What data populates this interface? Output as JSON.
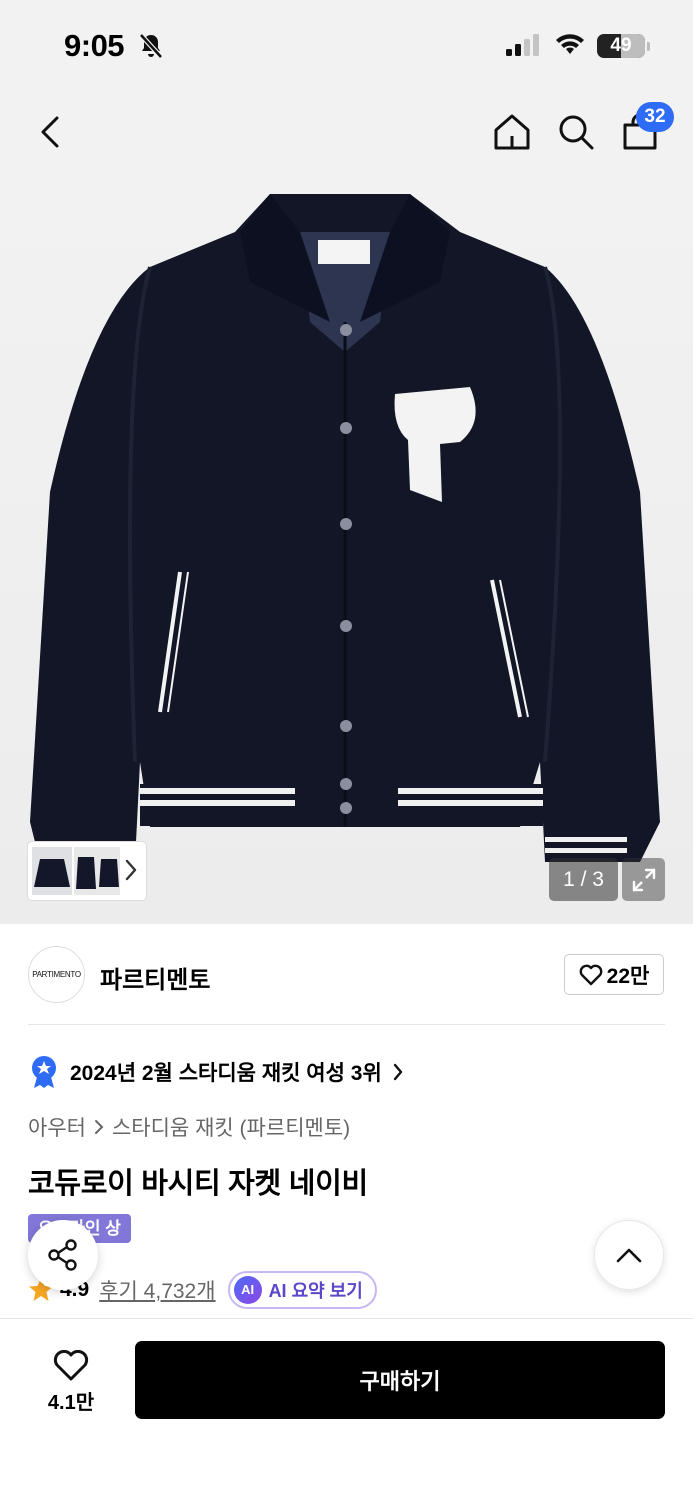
{
  "status_bar": {
    "time": "9:05",
    "battery": "49"
  },
  "header": {
    "cart_count": "32"
  },
  "gallery": {
    "counter": "1 / 3"
  },
  "brand": {
    "logo_text": "PARTIMENTO",
    "name": "파르티멘토",
    "likes": "22만"
  },
  "ranking": {
    "text": "2024년 2월 스타디움 재킷 여성 3위"
  },
  "breadcrumb": {
    "category": "아우터",
    "subcategory": "스타디움 재킷 (파르티멘토)"
  },
  "product": {
    "title": "코듀로이 바시티 자켓 네이비",
    "tag": "오프라인 상"
  },
  "reviews": {
    "rating": "4.9",
    "review_link": "후기 4,732개",
    "ai_badge": "AI",
    "ai_label": "AI 요약 보기"
  },
  "bottom_bar": {
    "wish_count": "4.1만",
    "buy_label": "구매하기"
  },
  "colors": {
    "accent_blue": "#2f6cf6",
    "ai_purple": "#5a47c9",
    "star": "#f5a623"
  }
}
